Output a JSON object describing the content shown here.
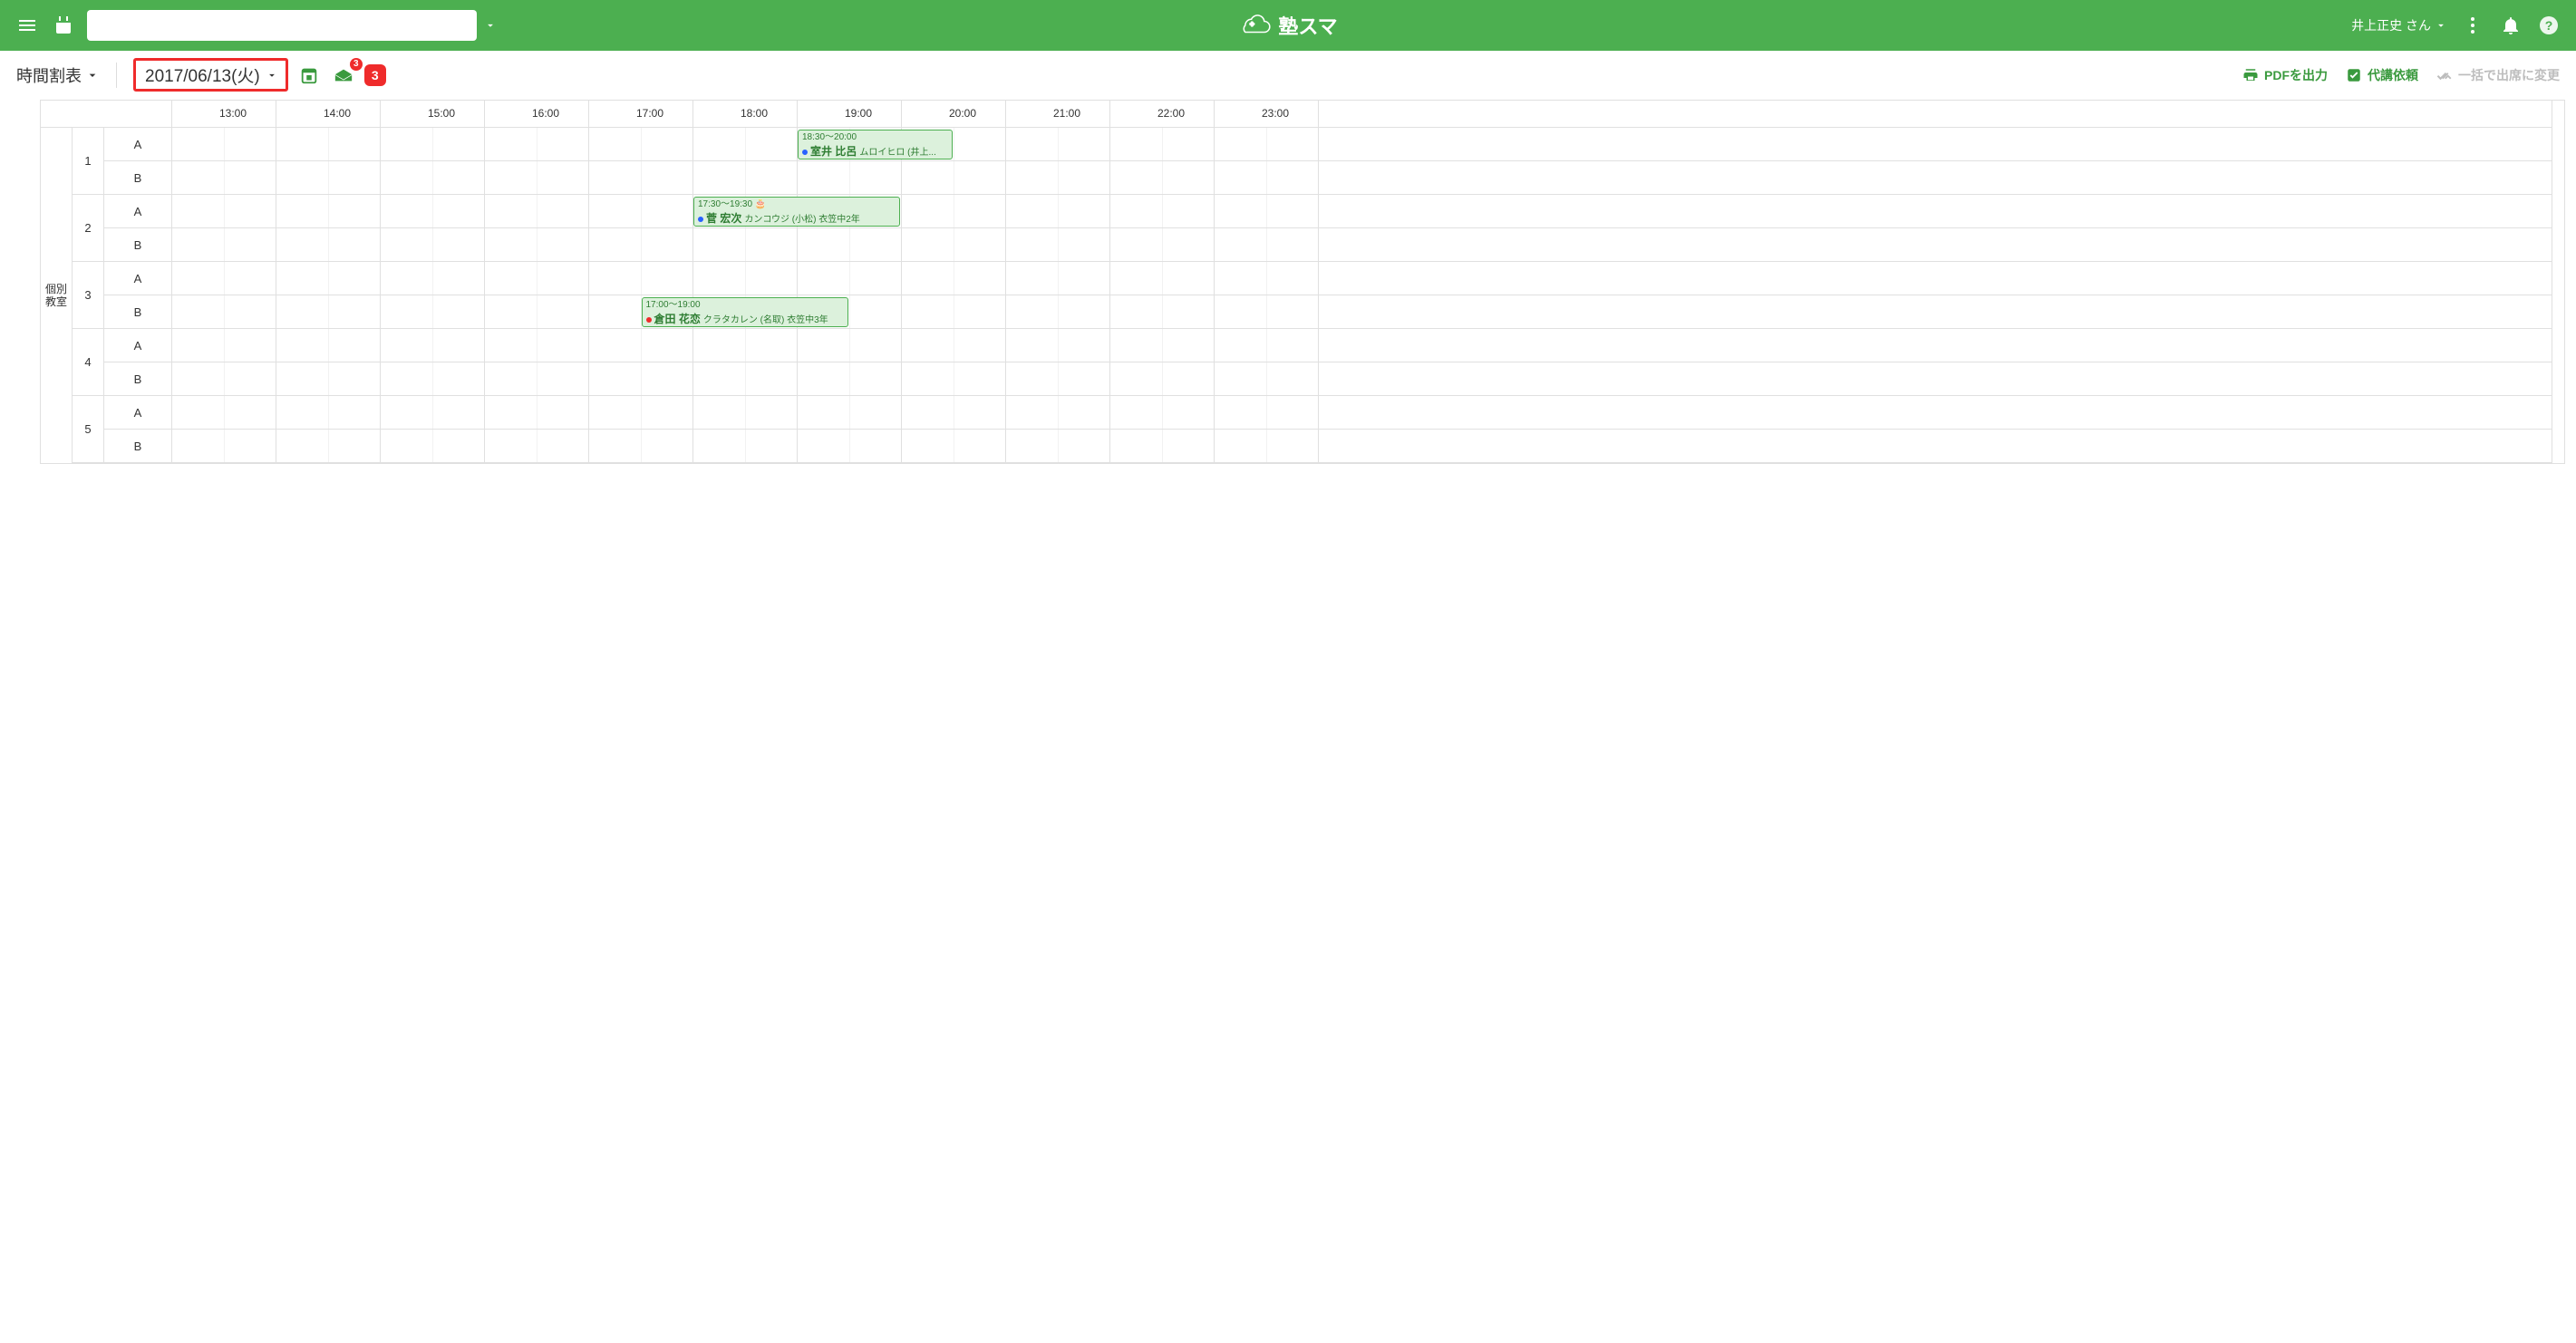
{
  "header": {
    "brand": "塾スマ",
    "user_label": "井上正史 さん",
    "search_placeholder": ""
  },
  "toolbar": {
    "view_label": "時間割表",
    "date_label": "2017/06/13(火)",
    "inbox_count": "3",
    "alert_count": "3",
    "pdf_label": "PDFを出力",
    "sub_label": "代講依頼",
    "attend_label": "一括で出席に変更"
  },
  "timetable": {
    "room_label": "個別\n教室",
    "hours": [
      "13:00",
      "14:00",
      "15:00",
      "16:00",
      "17:00",
      "18:00",
      "19:00",
      "20:00",
      "21:00",
      "22:00",
      "23:00"
    ],
    "booths": [
      {
        "num": "1",
        "seats": [
          "A",
          "B"
        ]
      },
      {
        "num": "2",
        "seats": [
          "A",
          "B"
        ]
      },
      {
        "num": "3",
        "seats": [
          "A",
          "B"
        ]
      },
      {
        "num": "4",
        "seats": [
          "A",
          "B"
        ]
      },
      {
        "num": "5",
        "seats": [
          "A",
          "B"
        ]
      }
    ],
    "events": [
      {
        "row": 0,
        "start_hour": 18.5,
        "end_hour": 20.0,
        "time": "18:30〜20:00",
        "dot": "blue",
        "name": "室井 比呂",
        "sub": "ムロイヒロ (井上...",
        "extra_icon": false
      },
      {
        "row": 2,
        "start_hour": 17.5,
        "end_hour": 19.5,
        "time": "17:30〜19:30",
        "dot": "blue",
        "name": "菅 宏次",
        "sub": "カンコウジ (小松) 衣笠中2年",
        "extra_icon": true
      },
      {
        "row": 5,
        "start_hour": 17.0,
        "end_hour": 19.0,
        "time": "17:00〜19:00",
        "dot": "red",
        "name": "倉田 花恋",
        "sub": "クラタカレン (名取) 衣笠中3年",
        "extra_icon": false
      }
    ]
  }
}
